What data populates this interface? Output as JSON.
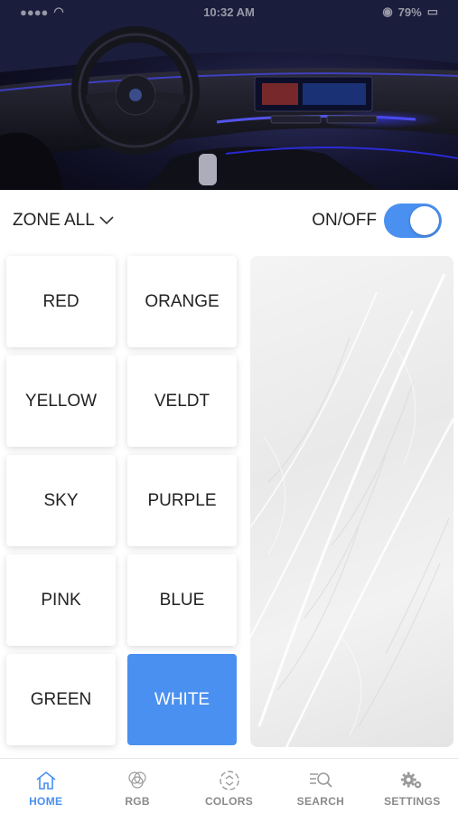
{
  "status_bar": {
    "time": "10:32 AM",
    "battery": "79%"
  },
  "zone": {
    "label": "ZONE ALL"
  },
  "power": {
    "label": "ON/OFF",
    "state": "on"
  },
  "colors": [
    {
      "label": "RED",
      "selected": false
    },
    {
      "label": "ORANGE",
      "selected": false
    },
    {
      "label": "YELLOW",
      "selected": false
    },
    {
      "label": "VELDT",
      "selected": false
    },
    {
      "label": "SKY",
      "selected": false
    },
    {
      "label": "PURPLE",
      "selected": false
    },
    {
      "label": "PINK",
      "selected": false
    },
    {
      "label": "BLUE",
      "selected": false
    },
    {
      "label": "GREEN",
      "selected": false
    },
    {
      "label": "WHITE",
      "selected": true
    }
  ],
  "accent_color": "#4a90f0",
  "tabs": [
    {
      "label": "HOME",
      "icon": "home-icon",
      "active": true
    },
    {
      "label": "RGB",
      "icon": "rgb-icon",
      "active": false
    },
    {
      "label": "COLORS",
      "icon": "colors-icon",
      "active": false
    },
    {
      "label": "SEARCH",
      "icon": "search-icon",
      "active": false
    },
    {
      "label": "SETTINGS",
      "icon": "gear-icon",
      "active": false
    }
  ]
}
